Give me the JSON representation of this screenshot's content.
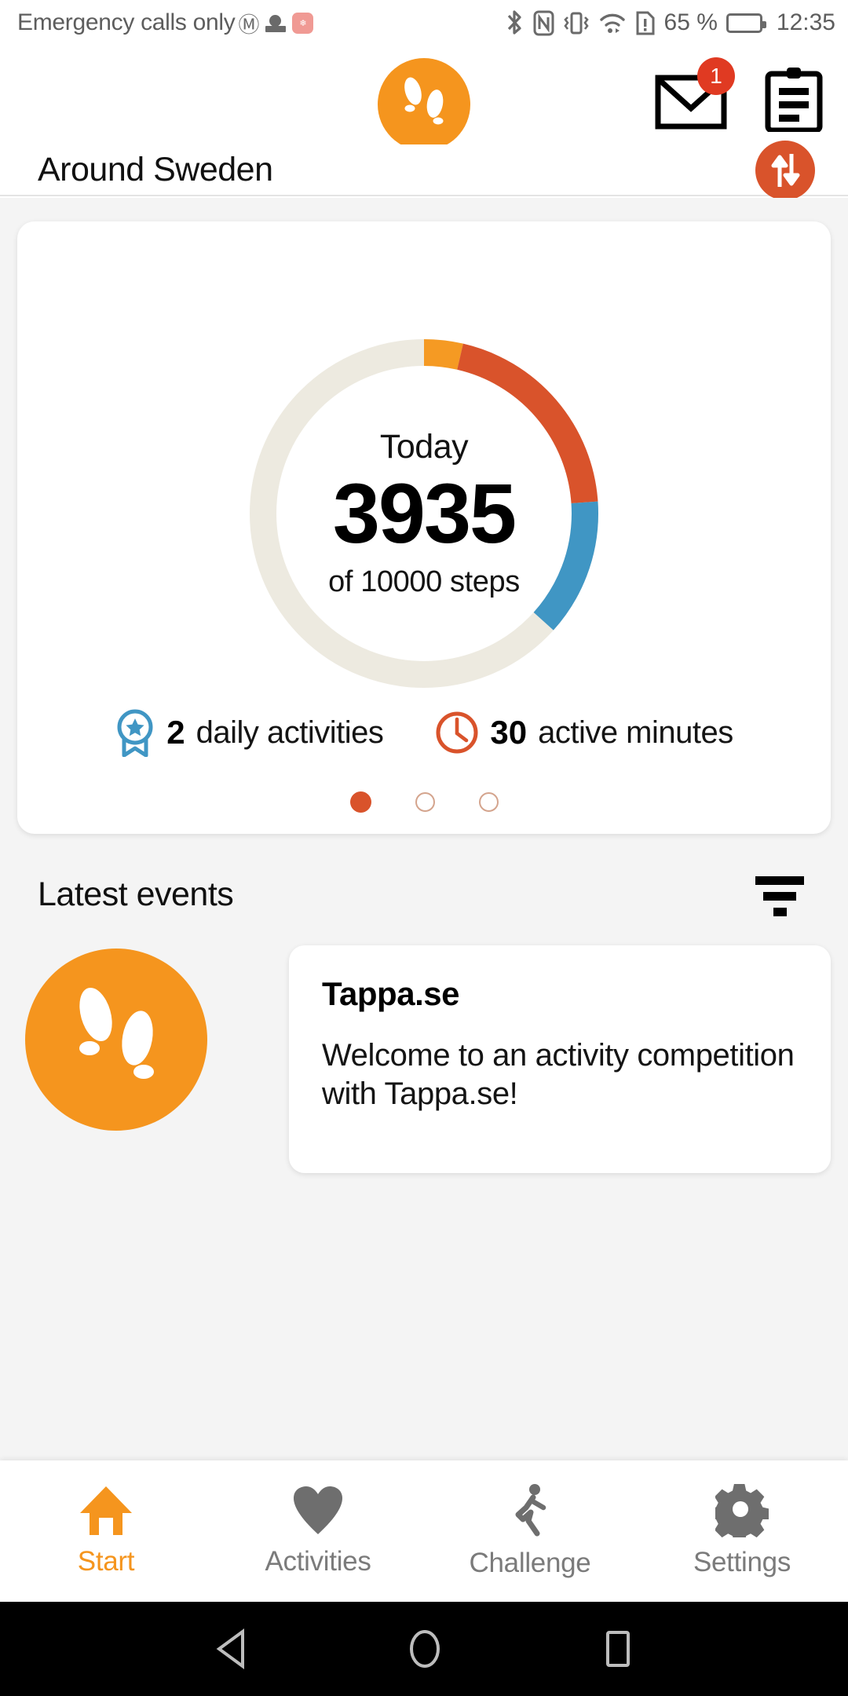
{
  "statusbar": {
    "carrier": "Emergency calls only",
    "icons": [
      "gmail-icon",
      "cast-icon",
      "huawei-icon",
      "bluetooth-icon",
      "nfc-icon",
      "vibrate-icon",
      "wifi-icon",
      "sim-alert-icon"
    ],
    "battery_percent": "65 %",
    "battery_level": 65,
    "clock": "12:35"
  },
  "header": {
    "logo_name": "tappa-footprints-logo",
    "mail_badge": "1",
    "mail_icon": "envelope-icon",
    "clipboard_icon": "clipboard-icon"
  },
  "titlebar": {
    "title": "Around Sweden",
    "sync_icon": "sync-arrows-icon"
  },
  "chart_data": {
    "type": "pie",
    "title": "Today",
    "center_label": "Today",
    "center_value": "3935",
    "center_sub": "of 10000 steps",
    "value": 3935,
    "goal": 10000,
    "unit": "steps",
    "segments": [
      {
        "name": "segment-amber",
        "color": "#F59A23",
        "degrees": 13
      },
      {
        "name": "segment-orange",
        "color": "#D9532B",
        "degrees": 73
      },
      {
        "name": "segment-blue",
        "color": "#4096C4",
        "degrees": 46
      },
      {
        "name": "track-empty",
        "color": "#EDEAE0",
        "degrees": 228
      }
    ],
    "legend_position": "none",
    "grid": false
  },
  "stats": [
    {
      "icon": "badge-star-icon",
      "icon_color": "#4096C4",
      "value": "2",
      "label": "daily activities"
    },
    {
      "icon": "clock-icon",
      "icon_color": "#D9532B",
      "value": "30",
      "label": "active minutes"
    }
  ],
  "pagination": {
    "count": 3,
    "active_index": 0,
    "active_color": "#D9532B"
  },
  "events": {
    "section_title": "Latest events",
    "filter_icon": "filter-icon",
    "items": [
      {
        "avatar_icon": "tappa-footprints-logo",
        "title": "Tappa.se",
        "text": "Welcome to an activity competition with Tappa.se!"
      }
    ]
  },
  "bottomnav": {
    "items": [
      {
        "icon": "home-icon",
        "label": "Start",
        "active": true
      },
      {
        "icon": "heart-icon",
        "label": "Activities",
        "active": false
      },
      {
        "icon": "runner-icon",
        "label": "Challenge",
        "active": false
      },
      {
        "icon": "gear-icon",
        "label": "Settings",
        "active": false
      }
    ],
    "active_color": "#F5951E"
  },
  "androidnav": {
    "back_icon": "back-triangle-icon",
    "home_icon": "home-circle-icon",
    "recents_icon": "recents-square-icon"
  }
}
